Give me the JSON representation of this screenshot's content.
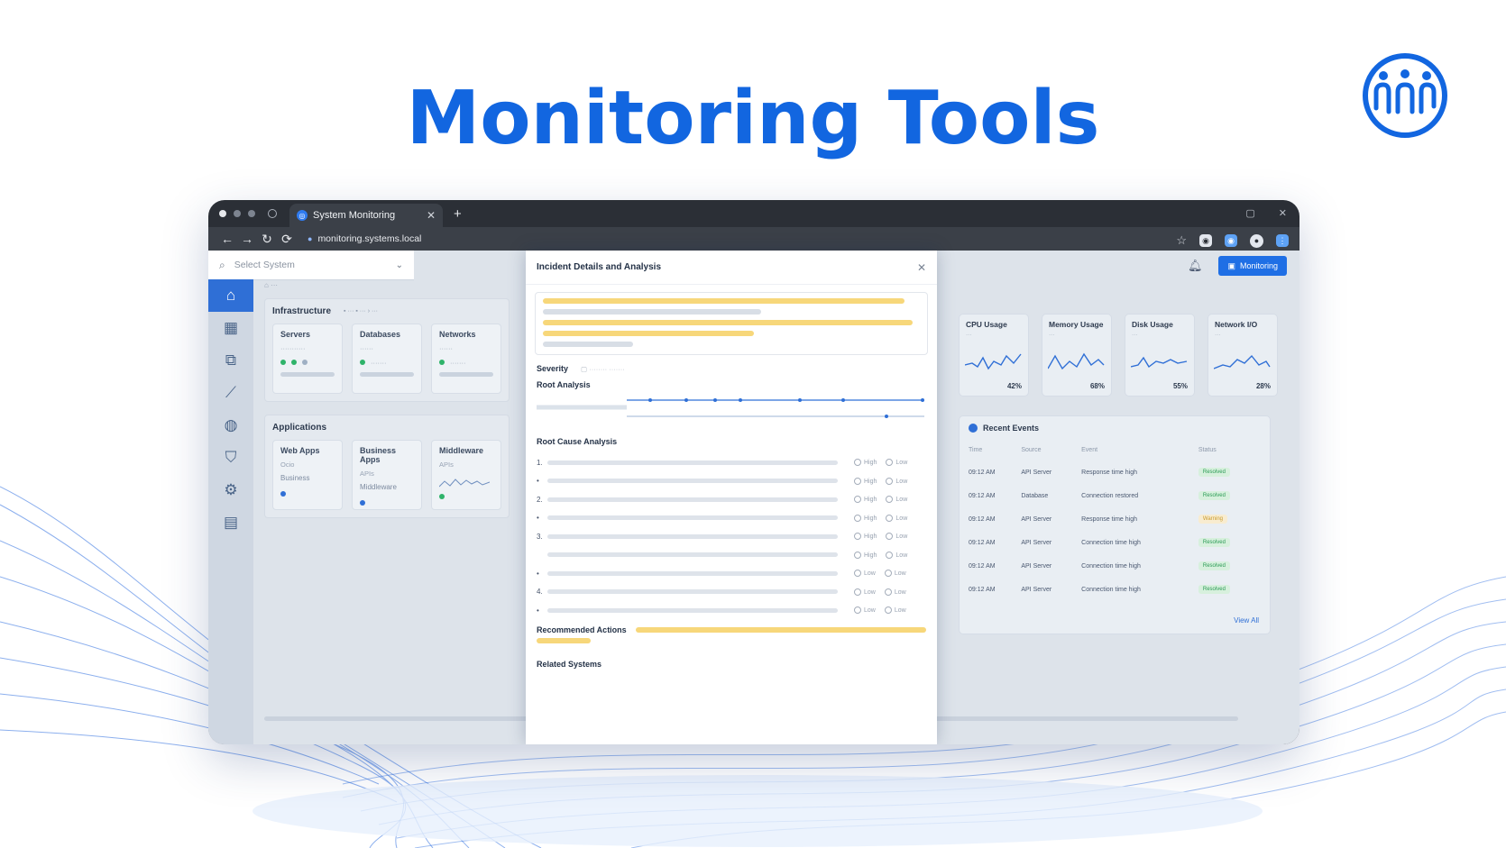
{
  "headline": "Monitoring Tools",
  "colors": {
    "brand_blue": "#1266e0",
    "accent": "#1f6fe5",
    "status_ok": "#2a9b55"
  },
  "browser": {
    "tab_title": "System Monitoring",
    "url": "monitoring.systems.local"
  },
  "app": {
    "select_placeholder": "Select System",
    "monitoring_button": "Monitoring",
    "sidebar_icons": [
      "home-icon",
      "servers-icon",
      "network-icon",
      "chart-icon",
      "security-icon",
      "shield-icon",
      "gear-icon",
      "document-icon"
    ],
    "infrastructure": {
      "title": "Infrastructure",
      "cards": [
        {
          "label": "Servers"
        },
        {
          "label": "Databases"
        },
        {
          "label": "Networks"
        }
      ]
    },
    "applications": {
      "title": "Applications",
      "cards": [
        {
          "label": "Web Apps",
          "sub": "Ocio",
          "sub2": "Business"
        },
        {
          "label": "Business Apps",
          "sub": "APIs",
          "sub2": "Middleware"
        },
        {
          "label": "Middleware",
          "sub": "APIs",
          "sub2": ""
        }
      ]
    },
    "modal": {
      "title": "Incident Details and Analysis",
      "severity_label": "Severity",
      "root_analysis_label": "Root Analysis",
      "root_cause_label": "Root Cause Analysis",
      "recommended_label": "Recommended Actions",
      "related_label": "Related Systems",
      "rca_rows": [
        {
          "num": "1.",
          "a": "High",
          "b": "Low"
        },
        {
          "num": "•",
          "a": "High",
          "b": "Low"
        },
        {
          "num": "2.",
          "a": "High",
          "b": "Low"
        },
        {
          "num": "•",
          "a": "High",
          "b": "Low"
        },
        {
          "num": "3.",
          "a": "High",
          "b": "Low"
        },
        {
          "num": "",
          "a": "High",
          "b": "Low"
        },
        {
          "num": "•",
          "a": "Low",
          "b": "Low"
        },
        {
          "num": "4.",
          "a": "Low",
          "b": "Low"
        },
        {
          "num": "•",
          "a": "Low",
          "b": "Low"
        }
      ]
    },
    "metrics": [
      {
        "label": "CPU Usage",
        "value": "42%"
      },
      {
        "label": "Memory Usage",
        "value": "68%"
      },
      {
        "label": "Disk Usage",
        "value": "55%"
      },
      {
        "label": "Network I/O",
        "value": "28%"
      }
    ],
    "events": {
      "title": "Recent Events",
      "columns": [
        "Time",
        "Source",
        "Event",
        "Status"
      ],
      "rows": [
        {
          "time": "09:12 AM",
          "source": "API Server",
          "event": "Response time high",
          "status": "Resolved",
          "kind": "ok"
        },
        {
          "time": "09:12 AM",
          "source": "Database",
          "event": "Connection restored",
          "status": "Resolved",
          "kind": "ok"
        },
        {
          "time": "09:12 AM",
          "source": "API Server",
          "event": "Response time high",
          "status": "Warning",
          "kind": "warn"
        },
        {
          "time": "09:12 AM",
          "source": "API Server",
          "event": "Connection time high",
          "status": "Resolved",
          "kind": "ok"
        },
        {
          "time": "09:12 AM",
          "source": "API Server",
          "event": "Connection time high",
          "status": "Resolved",
          "kind": "ok"
        },
        {
          "time": "09:12 AM",
          "source": "API Server",
          "event": "Connection time high",
          "status": "Resolved",
          "kind": "ok"
        }
      ],
      "view_all": "View All"
    }
  }
}
